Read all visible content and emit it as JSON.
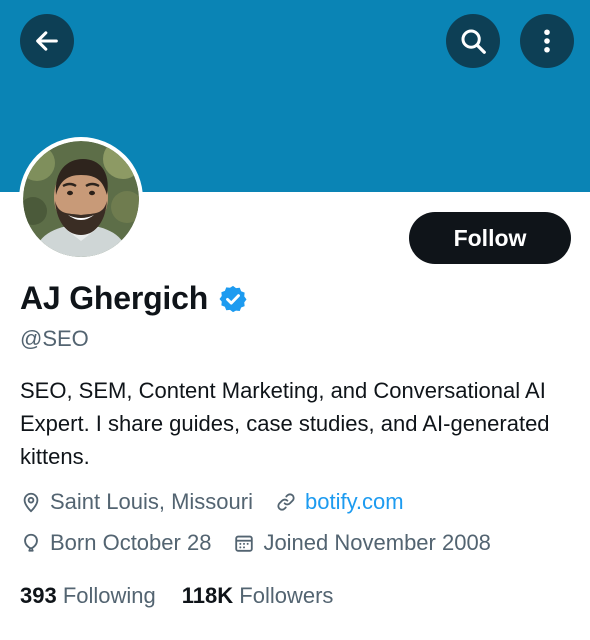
{
  "profile": {
    "display_name": "AJ Ghergich",
    "handle": "@SEO",
    "bio": "SEO, SEM, Content Marketing, and Conversational AI Expert. I share guides, case studies, and AI-generated kittens.",
    "location": "Saint Louis, Missouri",
    "website": "botify.com",
    "birthday": "Born October 28",
    "joined": "Joined November 2008",
    "verified": true
  },
  "actions": {
    "follow_label": "Follow"
  },
  "stats": {
    "following_count": "393",
    "following_label": "Following",
    "followers_count": "118K",
    "followers_label": "Followers"
  },
  "icons": {
    "back": "arrow-left-icon",
    "search": "search-icon",
    "more": "more-vertical-icon",
    "verified": "verified-badge-icon",
    "location": "location-pin-icon",
    "link": "link-icon",
    "birthday": "balloon-icon",
    "joined": "calendar-icon"
  },
  "colors": {
    "banner": "#0a84b5",
    "header_button": "#0d3f55",
    "follow_button": "#0f1419",
    "verified": "#1d9bf0",
    "link": "#1d9bf0",
    "secondary_text": "#536471"
  }
}
